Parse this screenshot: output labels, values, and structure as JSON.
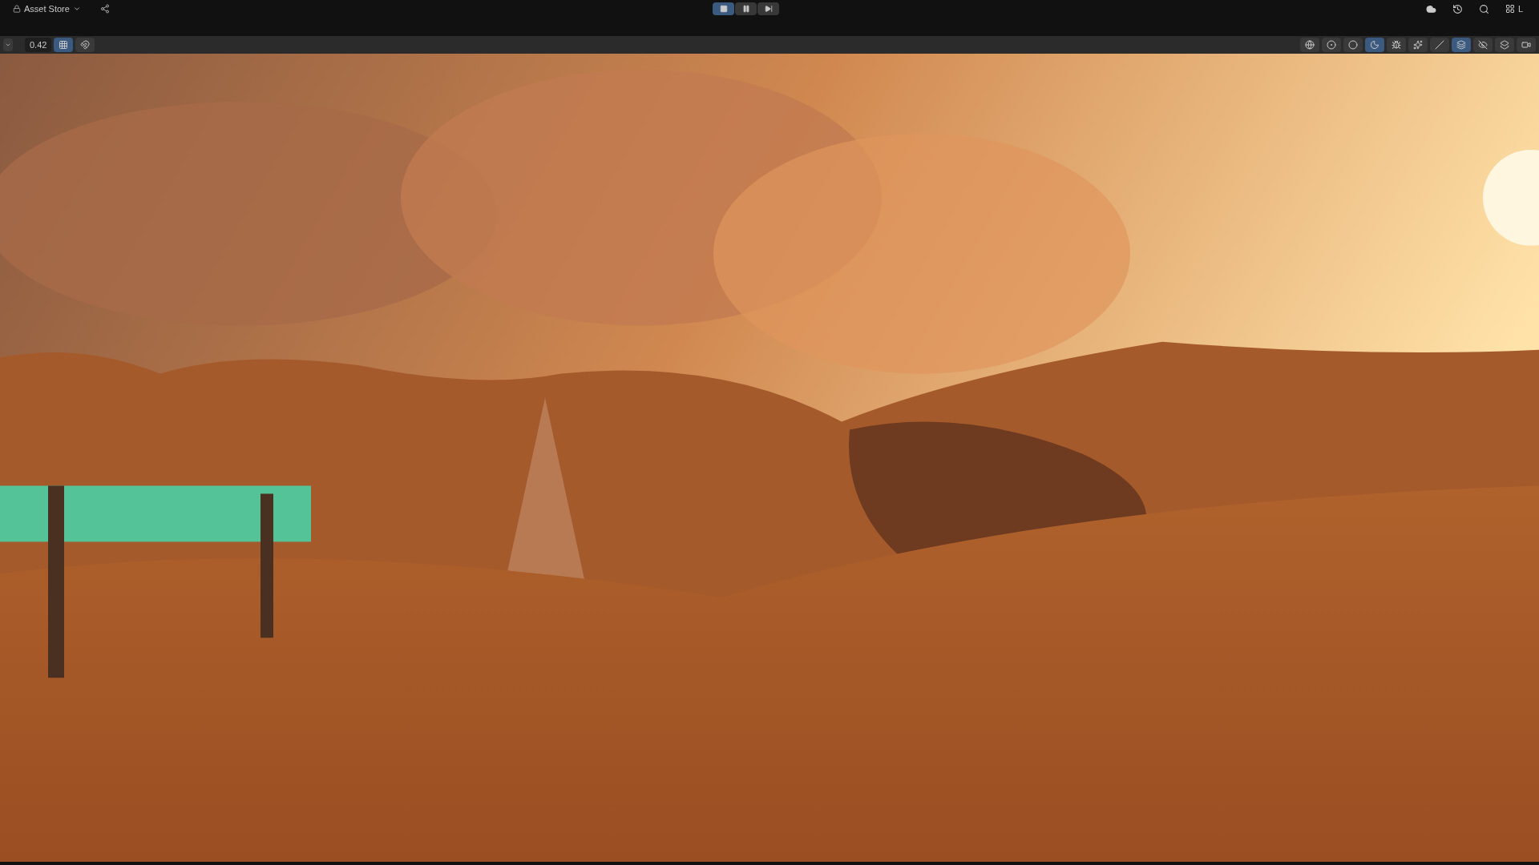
{
  "top_bar": {
    "account_menu": "Asset Store",
    "layout_menu": "L",
    "playback": [
      {
        "kind": "stop",
        "selected": true
      },
      {
        "kind": "pause",
        "selected": false
      },
      {
        "kind": "step",
        "selected": false
      }
    ]
  },
  "scene_toolbar": {
    "zoom_value": "0.42",
    "left_tools": [
      {
        "kind": "grid",
        "selected": true
      },
      {
        "kind": "snap",
        "selected": false
      }
    ],
    "right_tools": [
      {
        "kind": "wireframe",
        "selected": false
      },
      {
        "kind": "shaded-wire",
        "selected": false
      },
      {
        "kind": "shaded",
        "selected": false
      },
      {
        "kind": "lit",
        "selected": true
      },
      {
        "kind": "debug",
        "selected": false
      },
      {
        "kind": "fx",
        "selected": false
      },
      {
        "kind": "gizmo-2d",
        "selected": false
      },
      {
        "kind": "layers",
        "selected": true
      },
      {
        "kind": "hidden",
        "selected": false
      },
      {
        "kind": "stack",
        "selected": false
      },
      {
        "kind": "camera",
        "selected": false
      }
    ]
  }
}
